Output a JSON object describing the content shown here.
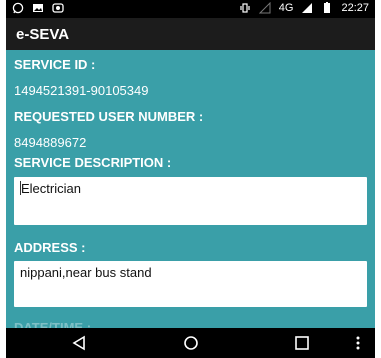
{
  "status_bar": {
    "network": "4G",
    "time": "22:27",
    "icons": [
      "whatsapp-icon",
      "image-icon",
      "camera-icon",
      "vibrate-icon",
      "signal-icon",
      "battery-icon"
    ]
  },
  "app_bar": {
    "title": "e-SEVA"
  },
  "form": {
    "service_id_label": "SERVICE ID :",
    "service_id_value": "1494521391-90105349",
    "requested_user_label": "REQUESTED USER NUMBER :",
    "requested_user_value": "8494889672",
    "service_description_label": "SERVICE DESCRIPTION :",
    "service_description_value": "Electrician",
    "address_label": "ADDRESS :",
    "address_value": "nippani,near bus stand",
    "datetime_label": "DATE/TIME :"
  },
  "nav_bar": {
    "icons": [
      "back-icon",
      "home-icon",
      "recent-apps-icon",
      "more-icon"
    ]
  },
  "colors": {
    "background": "#3a9fa8",
    "app_bar": "#1c1c1c",
    "status_bar": "#000000"
  }
}
